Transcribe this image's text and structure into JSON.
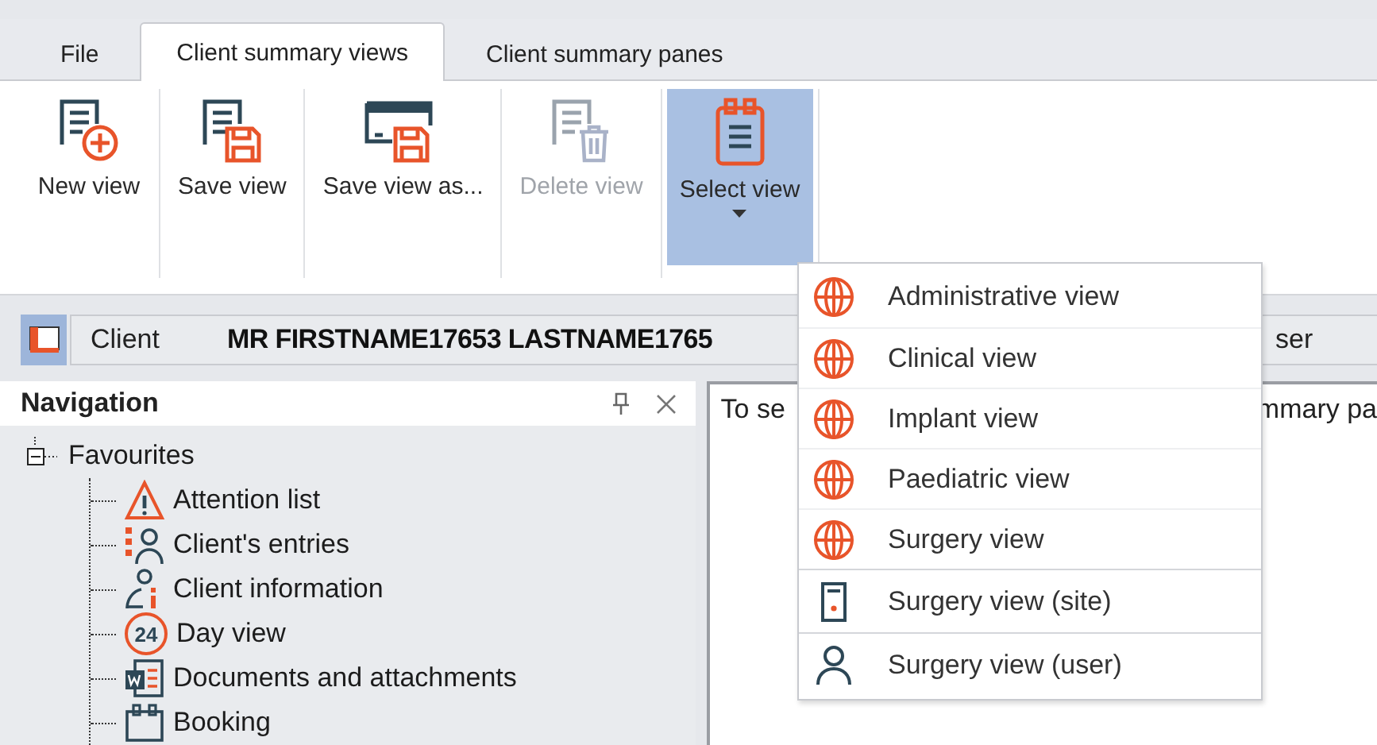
{
  "tabs": [
    {
      "label": "File",
      "selected": false
    },
    {
      "label": "Client summary views",
      "selected": true
    },
    {
      "label": "Client summary panes",
      "selected": false
    }
  ],
  "ribbon": [
    {
      "label": "New view",
      "kind": "new",
      "disabled": false,
      "selected": false,
      "dropdown": false
    },
    {
      "label": "Save view",
      "kind": "save",
      "disabled": false,
      "selected": false,
      "dropdown": false
    },
    {
      "label": "Save view as...",
      "kind": "saveas",
      "disabled": false,
      "selected": false,
      "dropdown": false
    },
    {
      "label": "Delete view",
      "kind": "delete",
      "disabled": true,
      "selected": false,
      "dropdown": false
    },
    {
      "label": "Select view",
      "kind": "select",
      "disabled": false,
      "selected": true,
      "dropdown": true
    }
  ],
  "client_bar": {
    "label": "Client",
    "name": "MR FIRSTNAME17653 LASTNAME1765",
    "trailing": "ser"
  },
  "navigation": {
    "title": "Navigation",
    "tree": [
      {
        "label": "Favourites",
        "expanded": true,
        "children": [
          {
            "label": "Attention list",
            "kind": "warning"
          },
          {
            "label": "Client's entries",
            "kind": "entries"
          },
          {
            "label": "Client information",
            "kind": "info"
          },
          {
            "label": "Day view",
            "kind": "day",
            "badge": "24"
          },
          {
            "label": "Documents and attachments",
            "kind": "docs"
          },
          {
            "label": "Booking",
            "kind": "booking"
          }
        ]
      }
    ]
  },
  "content": {
    "text_left": "To se",
    "text_right": "mmary pa"
  },
  "select_menu": [
    {
      "label": "Administrative view",
      "kind": "shared"
    },
    {
      "label": "Clinical view",
      "kind": "shared"
    },
    {
      "label": "Implant view",
      "kind": "shared"
    },
    {
      "label": "Paediatric view",
      "kind": "shared"
    },
    {
      "label": "Surgery view",
      "kind": "shared"
    },
    {
      "label": "Surgery view (site)",
      "kind": "site"
    },
    {
      "label": "Surgery view (user)",
      "kind": "user"
    }
  ]
}
